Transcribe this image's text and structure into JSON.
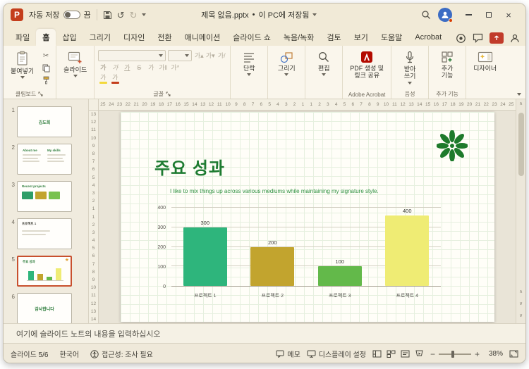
{
  "titlebar": {
    "autosave": "자동 저장",
    "autosave_state": "끔",
    "doc_title": "제목 없음.pptx",
    "doc_separator": "•",
    "doc_status": "이 PC에 저장됨"
  },
  "tabs": [
    {
      "name": "file",
      "label": "파일",
      "selected": false
    },
    {
      "name": "home",
      "label": "홈",
      "selected": true
    },
    {
      "name": "insert",
      "label": "삽입",
      "selected": false
    },
    {
      "name": "draw",
      "label": "그리기",
      "selected": false
    },
    {
      "name": "design",
      "label": "디자인",
      "selected": false
    },
    {
      "name": "transitions",
      "label": "전환",
      "selected": false
    },
    {
      "name": "animations",
      "label": "애니메이션",
      "selected": false
    },
    {
      "name": "slideshow",
      "label": "슬라이드 쇼",
      "selected": false
    },
    {
      "name": "record",
      "label": "녹음/녹화",
      "selected": false
    },
    {
      "name": "review",
      "label": "검토",
      "selected": false
    },
    {
      "name": "view",
      "label": "보기",
      "selected": false
    },
    {
      "name": "help",
      "label": "도움말",
      "selected": false
    },
    {
      "name": "acrobat",
      "label": "Acrobat",
      "selected": false
    }
  ],
  "ribbon": {
    "paste": "붙여넣기",
    "clipboard_group": "클립보드",
    "slide_button": "슬라이드",
    "font_group": "글꼴",
    "font_buttons_row1": [
      {
        "name": "grow-font",
        "glyph": "가▴"
      },
      {
        "name": "shrink-font",
        "glyph": "가▾"
      },
      {
        "name": "clear-formatting",
        "glyph": "가/"
      }
    ],
    "font_buttons_row2": [
      {
        "name": "bold",
        "glyph": "가",
        "cls": "b"
      },
      {
        "name": "italic",
        "glyph": "가",
        "cls": "i"
      },
      {
        "name": "underline",
        "glyph": "가",
        "cls": "u"
      },
      {
        "name": "strikethrough",
        "glyph": "S",
        "cls": "s"
      },
      {
        "name": "text-shadow",
        "glyph": "가",
        "cls": ""
      },
      {
        "name": "character-spacing",
        "glyph": "가‖",
        "cls": ""
      },
      {
        "name": "change-case",
        "glyph": "가*",
        "cls": ""
      }
    ],
    "font_buttons_row3": [
      {
        "name": "text-highlight-color",
        "glyph": "가",
        "bar": "#f3d93c"
      },
      {
        "name": "font-color",
        "glyph": "가",
        "bar": "#c43e1c"
      }
    ],
    "paragraph": "단락",
    "drawing": "그리기",
    "editing": "편집",
    "acrobat_button": [
      "PDF 생성 및",
      "링크 공유"
    ],
    "acrobat_group": "Adobe Acrobat",
    "dictate": [
      "받아",
      "쓰기"
    ],
    "voice_group": "음성",
    "addins": [
      "추가",
      "기능"
    ],
    "addins_group": "추가 기능",
    "designer": "디자이너"
  },
  "slide_panel": {
    "slides": [
      {
        "num": 1,
        "kind": "name",
        "selected": false,
        "texts": [
          "김도희"
        ]
      },
      {
        "num": 2,
        "kind": "two-col",
        "selected": false,
        "texts": [
          "About me",
          "My skills"
        ]
      },
      {
        "num": 3,
        "kind": "projects",
        "selected": false,
        "texts": [
          "Recent projects"
        ]
      },
      {
        "num": 4,
        "kind": "text",
        "selected": false,
        "texts": [
          "프로젝트 1"
        ]
      },
      {
        "num": 5,
        "kind": "chart",
        "selected": true,
        "texts": [
          "주요 성과"
        ]
      },
      {
        "num": 6,
        "kind": "thanks",
        "selected": false,
        "texts": [
          "감사합니다"
        ]
      }
    ]
  },
  "canvas": {
    "ruler_h": [
      25,
      24,
      23,
      22,
      21,
      20,
      19,
      18,
      17,
      16,
      15,
      14,
      13,
      12,
      11,
      10,
      9,
      8,
      7,
      6,
      5,
      4,
      3,
      2,
      1,
      1,
      2,
      3,
      4,
      5,
      6,
      7,
      8,
      9,
      10,
      11,
      12,
      13,
      14,
      15,
      16,
      17,
      18,
      19,
      20,
      21,
      22,
      23,
      24,
      25
    ],
    "ruler_v": [
      13,
      12,
      11,
      10,
      9,
      8,
      7,
      6,
      5,
      4,
      3,
      2,
      1,
      1,
      2,
      3,
      4,
      5,
      6,
      7,
      8,
      9,
      10,
      11,
      12,
      13,
      14
    ]
  },
  "slide": {
    "title": "주요 성과",
    "subtitle": "I like to mix things up across various mediums while maintaining my signature style."
  },
  "chart_data": {
    "type": "bar",
    "title": "주요 성과",
    "categories": [
      "프로젝트 1",
      "프로젝트 2",
      "프로젝트 3",
      "프로젝트 4"
    ],
    "values": [
      300,
      200,
      100,
      400
    ],
    "colors": [
      "#2eb57c",
      "#c2a42e",
      "#63b94a",
      "#efec74"
    ],
    "xlabel": "",
    "ylabel": "",
    "ylim": [
      0,
      400
    ],
    "yticks": [
      0,
      100,
      200,
      300,
      400
    ],
    "grid": true,
    "legend": "none"
  },
  "notes": {
    "placeholder": "여기에 슬라이드 노트의 내용을 입력하십시오"
  },
  "statusbar": {
    "slide_indicator": "슬라이드 5/6",
    "language": "한국어",
    "accessibility": "접근성: 조사 필요",
    "memo": "메모",
    "display_settings": "디스플레이 설정",
    "zoom_level": "38%"
  }
}
